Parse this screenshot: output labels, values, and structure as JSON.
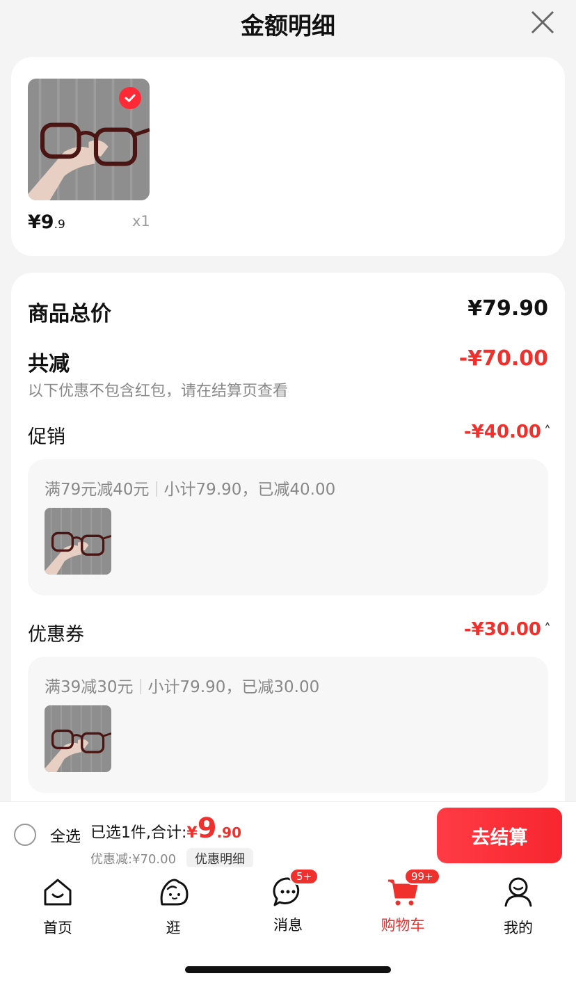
{
  "header": {
    "title": "金额明细"
  },
  "item": {
    "price_main": "¥9",
    "price_dec": ".9",
    "qty": "x1"
  },
  "summary": {
    "total_label": "商品总价",
    "total_value": "¥79.90",
    "reduce_label": "共减",
    "reduce_value": "-¥70.00",
    "note": "以下优惠不包含红包，请在结算页查看"
  },
  "promotion": {
    "label": "促销",
    "value": "-¥40.00",
    "rule": "满79元减40元",
    "detail": "小计79.90，已减40.00"
  },
  "coupon": {
    "label": "优惠券",
    "value": "-¥30.00",
    "rule": "满39减30元",
    "detail": "小计79.90，已减30.00"
  },
  "bottom": {
    "select_all": "全选",
    "selected_text": "已选1件,合计:",
    "yen": "¥",
    "total_int": "9",
    "total_dec": ".90",
    "discount": "优惠减:¥70.00",
    "detail_button": "优惠明细",
    "checkout": "去结算"
  },
  "tabs": [
    {
      "label": "首页",
      "icon": "home-icon"
    },
    {
      "label": "逛",
      "icon": "browse-icon"
    },
    {
      "label": "消息",
      "icon": "message-icon",
      "badge": "5+"
    },
    {
      "label": "购物车",
      "icon": "cart-icon",
      "badge": "99+",
      "active": true
    },
    {
      "label": "我的",
      "icon": "profile-icon"
    }
  ],
  "colors": {
    "accent": "#f0302c",
    "checkout_gradient": [
      "#ff3b44",
      "#f7262f"
    ]
  }
}
